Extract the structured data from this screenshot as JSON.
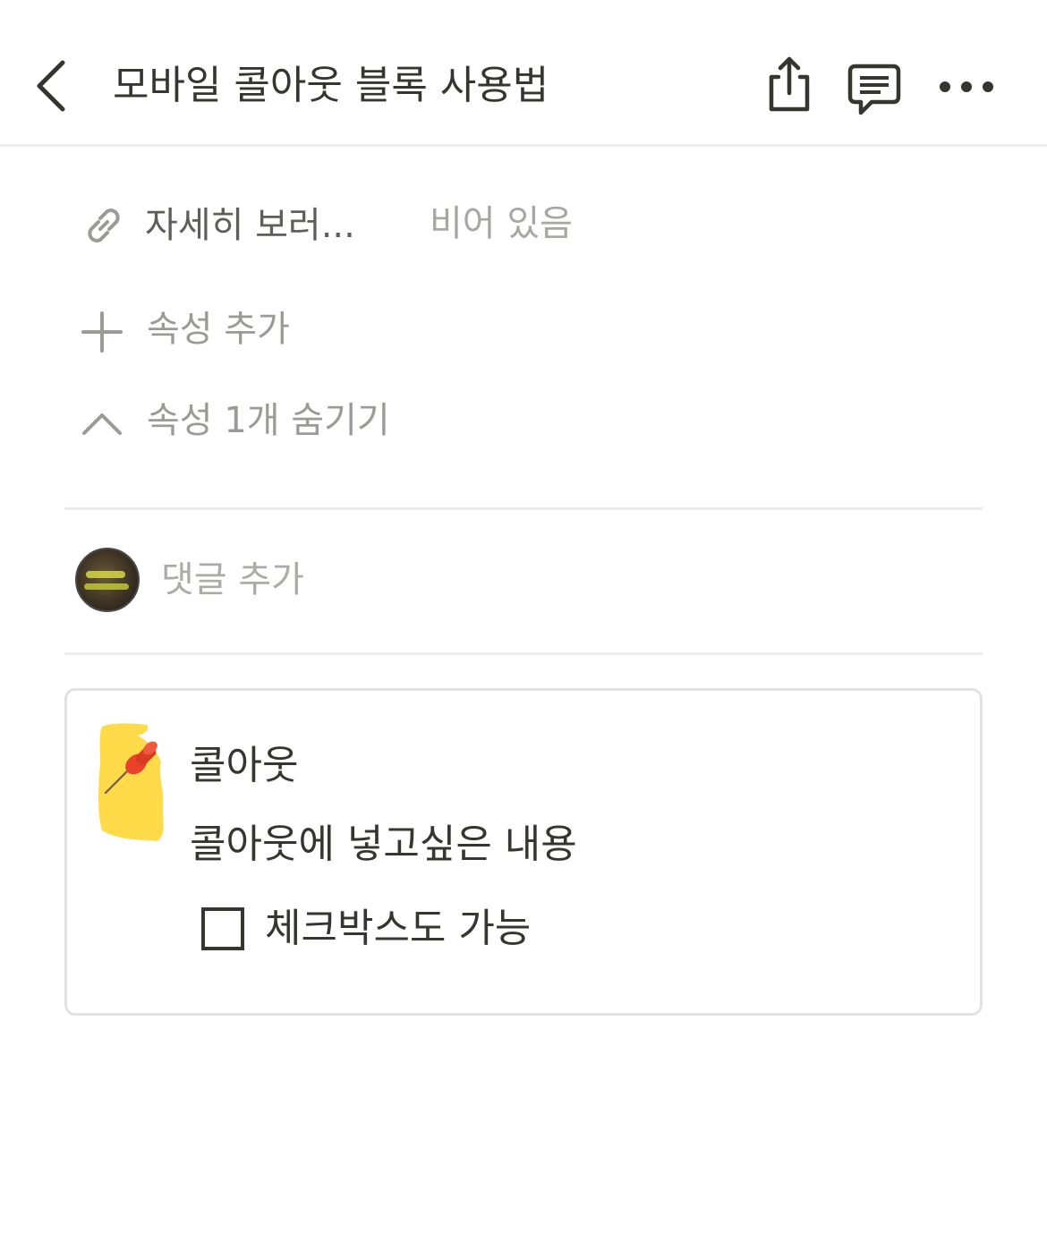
{
  "header": {
    "title": "모바일 콜아웃 블록 사용법",
    "back_icon": "chevron-left-icon",
    "share_icon": "share-icon",
    "comment_icon": "comment-icon",
    "more_icon": "more-horizontal-icon"
  },
  "properties": {
    "items": [
      {
        "icon": "link-icon",
        "label": "자세히 보러...",
        "value": "비어 있음"
      }
    ],
    "add_property_label": "속성 추가",
    "hide_properties_label": "속성 1개 숨기기"
  },
  "comments": {
    "placeholder": "댓글 추가",
    "avatar": "user-avatar"
  },
  "callout": {
    "icon": "pushpin-icon",
    "title": "콜아웃",
    "body": "콜아웃에 넣고싶은 내용",
    "todo": {
      "label": "체크박스도 가능",
      "checked": false
    }
  },
  "colors": {
    "text": "#37352f",
    "muted": "#9b9a97",
    "divider": "#ededec",
    "callout_border": "#e3e2e0",
    "highlight": "#ffd83a",
    "pin": "#e8432a"
  }
}
